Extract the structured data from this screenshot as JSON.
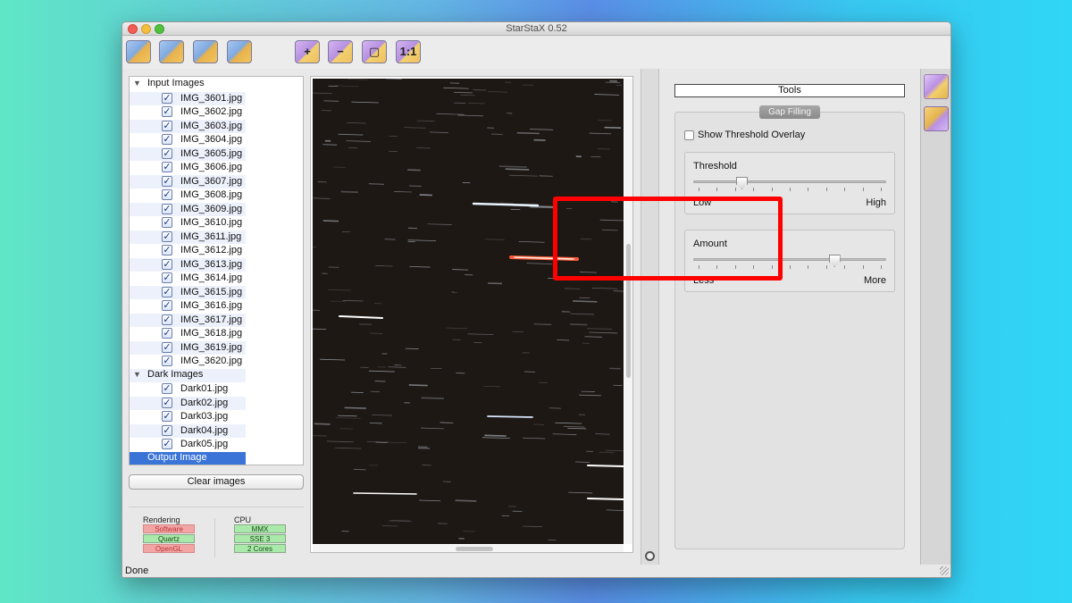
{
  "window": {
    "title": "StarStaX 0.52"
  },
  "toolbar": {
    "buttons": [
      {
        "name": "open-images-button",
        "icon": "folder-open-icon",
        "glyph": ""
      },
      {
        "name": "open-dark-images-button",
        "icon": "folder-dark-icon",
        "glyph": ""
      },
      {
        "name": "save-image-button",
        "icon": "save-icon",
        "glyph": ""
      },
      {
        "name": "export-button",
        "icon": "export-icon",
        "glyph": ""
      },
      {
        "name": "zoom-in-button",
        "icon": "zoom-in-icon",
        "glyph": "+"
      },
      {
        "name": "zoom-out-button",
        "icon": "zoom-out-icon",
        "glyph": "−"
      },
      {
        "name": "zoom-fit-button",
        "icon": "zoom-fit-icon",
        "glyph": "▢"
      },
      {
        "name": "zoom-actual-button",
        "icon": "zoom-actual-icon",
        "glyph": "1:1"
      }
    ]
  },
  "tree": {
    "input_group": "Input Images",
    "input_images": [
      "IMG_3601.jpg",
      "IMG_3602.jpg",
      "IMG_3603.jpg",
      "IMG_3604.jpg",
      "IMG_3605.jpg",
      "IMG_3606.jpg",
      "IMG_3607.jpg",
      "IMG_3608.jpg",
      "IMG_3609.jpg",
      "IMG_3610.jpg",
      "IMG_3611.jpg",
      "IMG_3612.jpg",
      "IMG_3613.jpg",
      "IMG_3614.jpg",
      "IMG_3615.jpg",
      "IMG_3616.jpg",
      "IMG_3617.jpg",
      "IMG_3618.jpg",
      "IMG_3619.jpg",
      "IMG_3620.jpg"
    ],
    "dark_group": "Dark Images",
    "dark_images": [
      "Dark01.jpg",
      "Dark02.jpg",
      "Dark03.jpg",
      "Dark04.jpg",
      "Dark05.jpg"
    ],
    "output": "Output Image",
    "checkmark": "✓"
  },
  "clear_button": "Clear images",
  "info": {
    "rendering_title": "Rendering",
    "rendering": [
      {
        "label": "Software",
        "state": "off"
      },
      {
        "label": "Quartz",
        "state": "on"
      },
      {
        "label": "OpenGL",
        "state": "off"
      }
    ],
    "cpu_title": "CPU",
    "cpu": [
      {
        "label": "MMX",
        "state": "on"
      },
      {
        "label": "SSE 3",
        "state": "on"
      },
      {
        "label": "2 Cores",
        "state": "on"
      }
    ]
  },
  "status": "Done",
  "tools": {
    "header": "Tools",
    "section": "Gap Filling",
    "show_threshold_overlay": "Show Threshold Overlay",
    "threshold": {
      "title": "Threshold",
      "low": "Low",
      "high": "High",
      "value": 0.25
    },
    "amount": {
      "title": "Amount",
      "low": "Less",
      "high": "More",
      "value": 0.73
    }
  },
  "sidebar": {
    "buttons": [
      {
        "name": "blending-mode-button",
        "icon": "blend-icon"
      },
      {
        "name": "gap-filling-button",
        "icon": "wand-icon"
      }
    ]
  },
  "colors": {
    "highlight": "#ff0000",
    "selection": "#3a74d6"
  }
}
